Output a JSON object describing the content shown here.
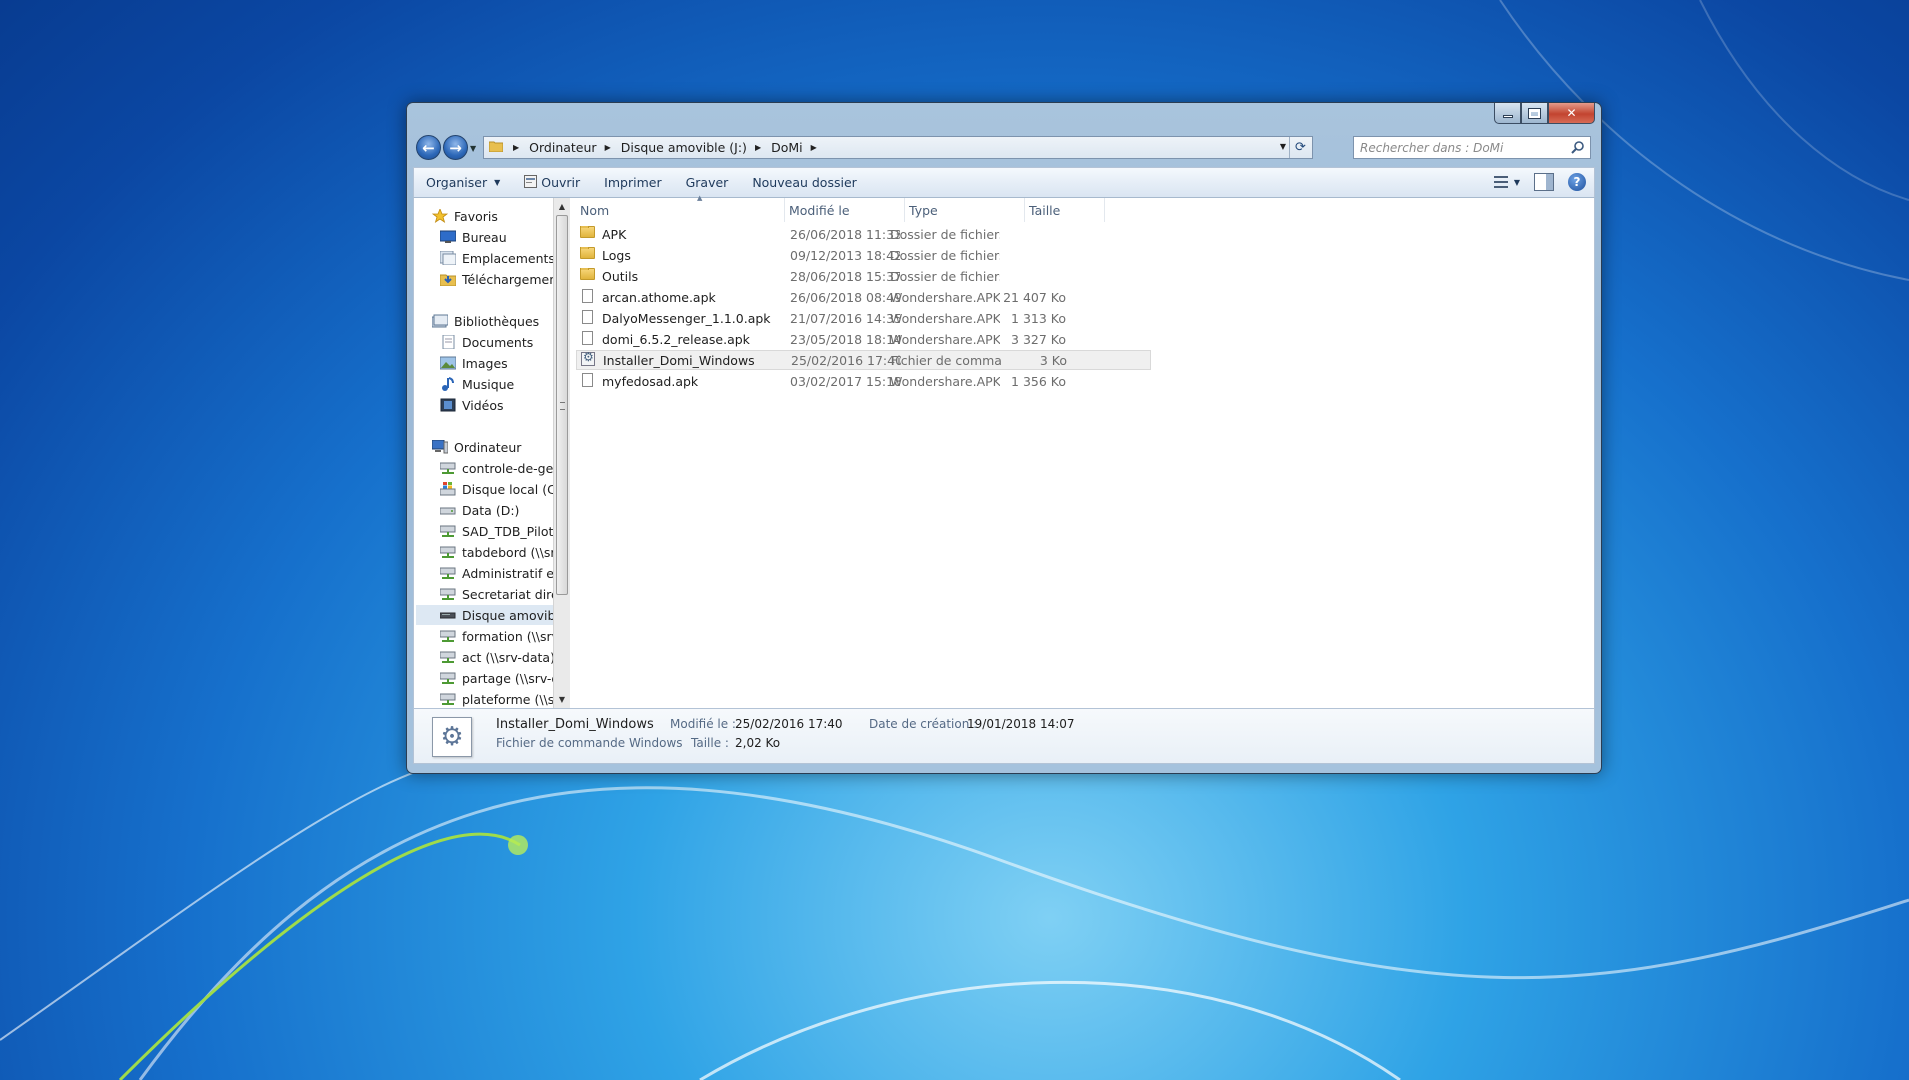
{
  "window": {
    "minimize": "—",
    "maximize": "□",
    "close": "✕"
  },
  "address_bar": {
    "crumbs": [
      "Ordinateur",
      "Disque amovible (J:)",
      "DoMi"
    ]
  },
  "search": {
    "placeholder": "Rechercher dans : DoMi"
  },
  "toolbar": {
    "organize": "Organiser",
    "open": "Ouvrir",
    "print": "Imprimer",
    "burn": "Graver",
    "new_folder": "Nouveau dossier"
  },
  "navigation": {
    "favorites": {
      "label": "Favoris",
      "items": [
        "Bureau",
        "Emplacements ré",
        "Téléchargements"
      ]
    },
    "libraries": {
      "label": "Bibliothèques",
      "items": [
        "Documents",
        "Images",
        "Musique",
        "Vidéos"
      ]
    },
    "computer": {
      "label": "Ordinateur",
      "items": [
        "controle-de-gest",
        "Disque local (C:)",
        "Data (D:)",
        "SAD_TDB_Pilotag",
        "tabdebord (\\\\srv-",
        "Administratif et f",
        "Secretariat direct",
        "Disque amovible",
        "formation (\\\\srv-",
        "act (\\\\srv-data) (I",
        "partage (\\\\srv-da",
        "plateforme (\\\\srv"
      ],
      "selected_index": 7
    }
  },
  "columns": {
    "name": "Nom",
    "modified": "Modifié le",
    "type": "Type",
    "size": "Taille"
  },
  "files": [
    {
      "name": "APK",
      "modified": "26/06/2018 11:33",
      "type": "Dossier de fichiers",
      "size": "",
      "icon": "folder-icon"
    },
    {
      "name": "Logs",
      "modified": "09/12/2013 18:42",
      "type": "Dossier de fichiers",
      "size": "",
      "icon": "folder-icon"
    },
    {
      "name": "Outils",
      "modified": "28/06/2018 15:37",
      "type": "Dossier de fichiers",
      "size": "",
      "icon": "folder-icon"
    },
    {
      "name": "arcan.athome.apk",
      "modified": "26/06/2018 08:49",
      "type": "Wondershare.APK...",
      "size": "21 407 Ko",
      "icon": "file-icon"
    },
    {
      "name": "DalyoMessenger_1.1.0.apk",
      "modified": "21/07/2016 14:35",
      "type": "Wondershare.APK...",
      "size": "1 313 Ko",
      "icon": "file-icon"
    },
    {
      "name": "domi_6.5.2_release.apk",
      "modified": "23/05/2018 18:14",
      "type": "Wondershare.APK...",
      "size": "3 327 Ko",
      "icon": "file-icon"
    },
    {
      "name": "Installer_Domi_Windows",
      "modified": "25/02/2016 17:40",
      "type": "Fichier de comma...",
      "size": "3 Ko",
      "icon": "command-file-icon",
      "selected": true
    },
    {
      "name": "myfedosad.apk",
      "modified": "03/02/2017 15:18",
      "type": "Wondershare.APK...",
      "size": "1 356 Ko",
      "icon": "file-icon"
    }
  ],
  "details": {
    "name": "Installer_Domi_Windows",
    "type": "Fichier de commande Windows",
    "modified_label": "Modifié le :",
    "modified_value": "25/02/2016 17:40",
    "size_label": "Taille :",
    "size_value": "2,02 Ko",
    "created_label": "Date de création :",
    "created_value": "19/01/2018 14:07"
  }
}
